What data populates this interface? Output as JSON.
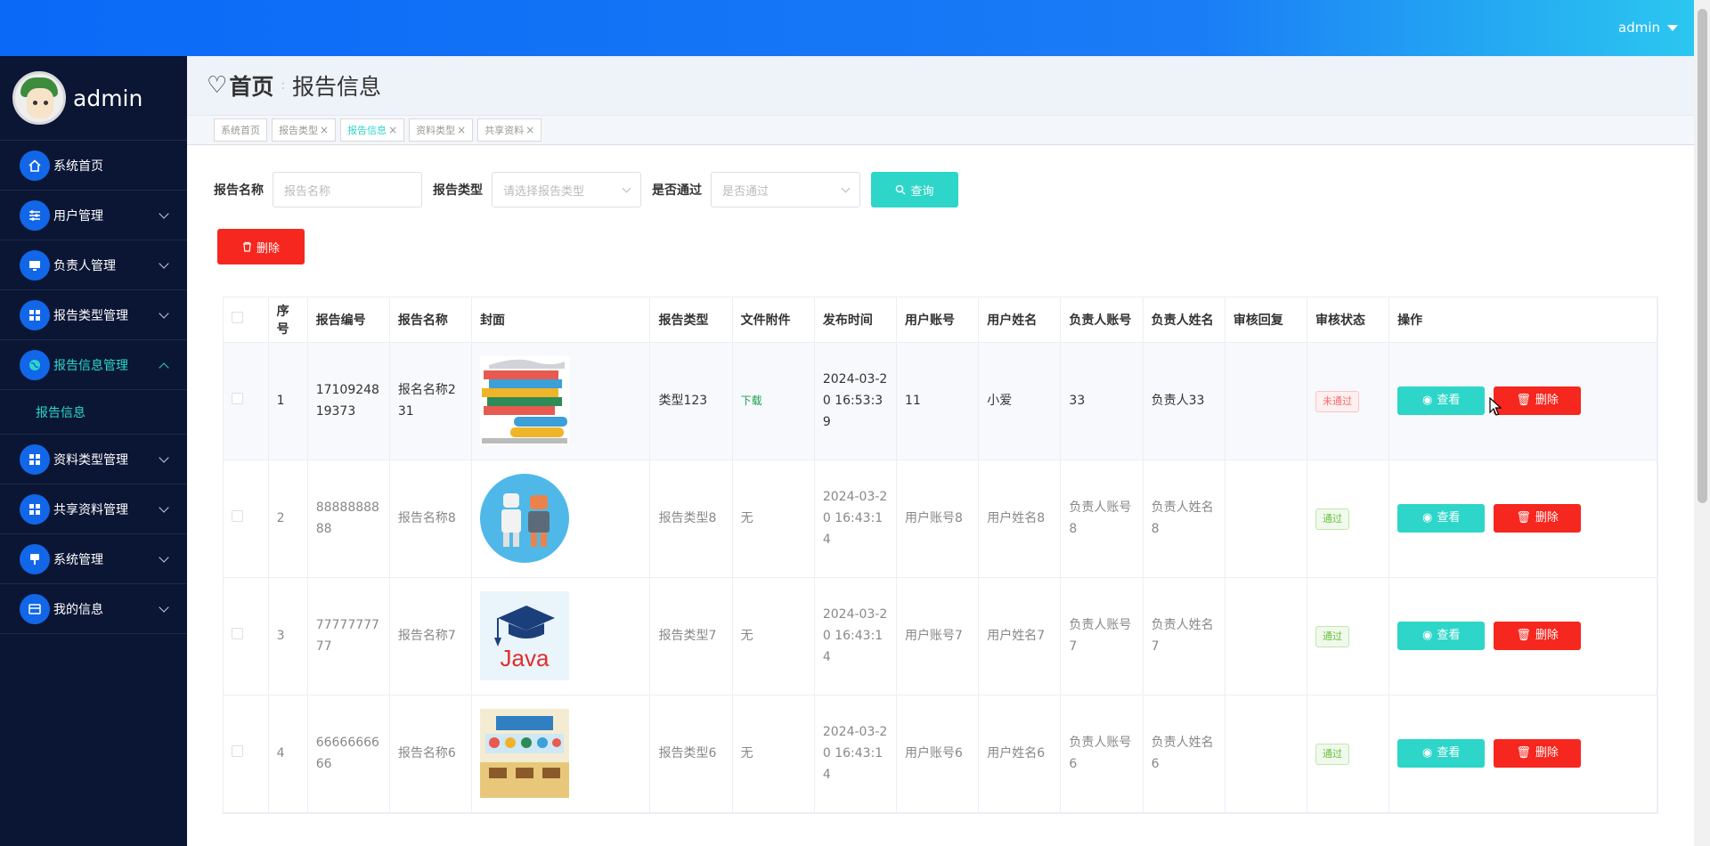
{
  "header": {
    "user": "admin"
  },
  "sidebar": {
    "profile_name": "admin",
    "items": [
      {
        "label": "系统首页",
        "icon": "home-icon"
      },
      {
        "label": "用户管理",
        "icon": "sliders-icon"
      },
      {
        "label": "负责人管理",
        "icon": "monitor-icon"
      },
      {
        "label": "报告类型管理",
        "icon": "grid-icon"
      },
      {
        "label": "报告信息管理",
        "icon": "globe-icon"
      },
      {
        "label": "资料类型管理",
        "icon": "grid-icon"
      },
      {
        "label": "共享资料管理",
        "icon": "grid-icon"
      },
      {
        "label": "系统管理",
        "icon": "pin-icon"
      },
      {
        "label": "我的信息",
        "icon": "card-icon"
      }
    ],
    "sub_item": "报告信息"
  },
  "breadcrumb": {
    "home": "首页",
    "current": "报告信息"
  },
  "tags": [
    {
      "label": "系统首页"
    },
    {
      "label": "报告类型"
    },
    {
      "label": "报告信息"
    },
    {
      "label": "资料类型"
    },
    {
      "label": "共享资料"
    }
  ],
  "search": {
    "name_label": "报告名称",
    "name_placeholder": "报告名称",
    "type_label": "报告类型",
    "type_placeholder": "请选择报告类型",
    "pass_label": "是否通过",
    "pass_placeholder": "是否通过",
    "query_button": "查询"
  },
  "delete_button": "删除",
  "table": {
    "headers": [
      "序号",
      "报告编号",
      "报告名称",
      "封面",
      "报告类型",
      "文件附件",
      "发布时间",
      "用户账号",
      "用户姓名",
      "负责人账号",
      "负责人姓名",
      "审核回复",
      "审核状态",
      "操作"
    ],
    "rows": [
      {
        "no": "1",
        "code": "1710924819373",
        "name": "报名名称231",
        "cover": "books",
        "type": "类型123",
        "file": "下载",
        "time": "2024-03-20 16:53:39",
        "account": "11",
        "username": "小爱",
        "mgr_account": "33",
        "mgr_name": "负责人33",
        "reply": "",
        "status": "未通过"
      },
      {
        "no": "2",
        "code": "8888888888",
        "name": "报告名称8",
        "cover": "robots",
        "type": "报告类型8",
        "file": "无",
        "time": "2024-03-20 16:43:14",
        "account": "用户账号8",
        "username": "用户姓名8",
        "mgr_account": "负责人账号8",
        "mgr_name": "负责人姓名8",
        "reply": "",
        "status": "通过"
      },
      {
        "no": "3",
        "code": "7777777777",
        "name": "报告名称7",
        "cover": "java",
        "type": "报告类型7",
        "file": "无",
        "time": "2024-03-20 16:43:14",
        "account": "用户账号7",
        "username": "用户姓名7",
        "mgr_account": "负责人账号7",
        "mgr_name": "负责人姓名7",
        "reply": "",
        "status": "通过"
      },
      {
        "no": "4",
        "code": "6666666666",
        "name": "报告名称6",
        "cover": "classroom",
        "type": "报告类型6",
        "file": "无",
        "time": "2024-03-20 16:43:14",
        "account": "用户账号6",
        "username": "用户姓名6",
        "mgr_account": "负责人账号6",
        "mgr_name": "负责人姓名6",
        "reply": "",
        "status": "通过"
      }
    ],
    "view_button": "查看",
    "delete_button": "删除"
  },
  "colors": {
    "accent": "#2dd6c8",
    "danger": "#f5271f",
    "sidebar": "#0b1635",
    "header": "#0a69f7"
  }
}
